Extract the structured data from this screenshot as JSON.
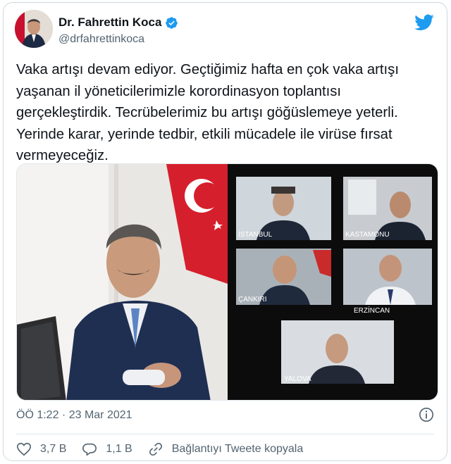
{
  "author": {
    "name": "Dr. Fahrettin Koca",
    "handle": "@drfahrettinkoca"
  },
  "tweet": {
    "text": "Vaka artışı devam ediyor. Geçtiğimiz hafta en çok vaka artışı yaşanan il yöneticilerimizle korordinasyon toplantısı gerçekleştirdik. Tecrübelerimiz bu artışı göğüslemeye yeterli. Yerinde karar, yerinde tedbir, etkili mücadele ile virüse fırsat vermeyeceğiz."
  },
  "media": {
    "video_labels": [
      "İSTANBUL",
      "KASTAMONU",
      "ÇANKIRI",
      "ERZİNCAN",
      "YALOVA"
    ]
  },
  "meta": {
    "timestamp": "ÖÖ 1:22 · 23 Mar 2021"
  },
  "actions": {
    "likes": "3,7 B",
    "replies": "1,1 B",
    "copy_link": "Bağlantıyı Tweete kopyala"
  },
  "colors": {
    "brand": "#1d9bf0",
    "text": "#0f1419",
    "muted": "#536471",
    "border": "#cfd9de"
  },
  "icons": [
    "verified-badge-icon",
    "twitter-bird-icon",
    "info-icon",
    "heart-icon",
    "reply-icon",
    "link-icon"
  ]
}
